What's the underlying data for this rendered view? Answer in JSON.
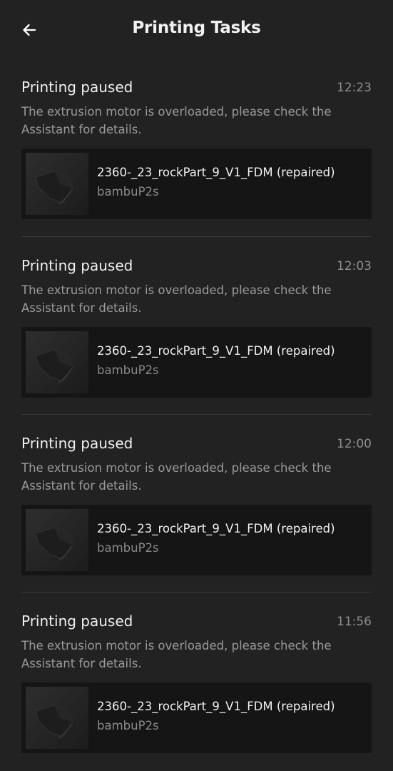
{
  "header": {
    "title": "Printing Tasks",
    "back_icon": "arrow-left-icon"
  },
  "tasks": [
    {
      "title": "Printing paused",
      "time": "12:23",
      "message": "The extrusion motor is overloaded, please check the Assistant for details.",
      "job_name": "2360-_23_rockPart_9_V1_FDM (repaired)",
      "printer": "bambuP2s"
    },
    {
      "title": "Printing paused",
      "time": "12:03",
      "message": "The extrusion motor is overloaded, please check the Assistant for details.",
      "job_name": "2360-_23_rockPart_9_V1_FDM (repaired)",
      "printer": "bambuP2s"
    },
    {
      "title": "Printing paused",
      "time": "12:00",
      "message": "The extrusion motor is overloaded, please check the Assistant for details.",
      "job_name": "2360-_23_rockPart_9_V1_FDM (repaired)",
      "printer": "bambuP2s"
    },
    {
      "title": "Printing paused",
      "time": "11:56",
      "message": "The extrusion motor is overloaded, please check the Assistant for details.",
      "job_name": "2360-_23_rockPart_9_V1_FDM (repaired)",
      "printer": "bambuP2s"
    }
  ]
}
